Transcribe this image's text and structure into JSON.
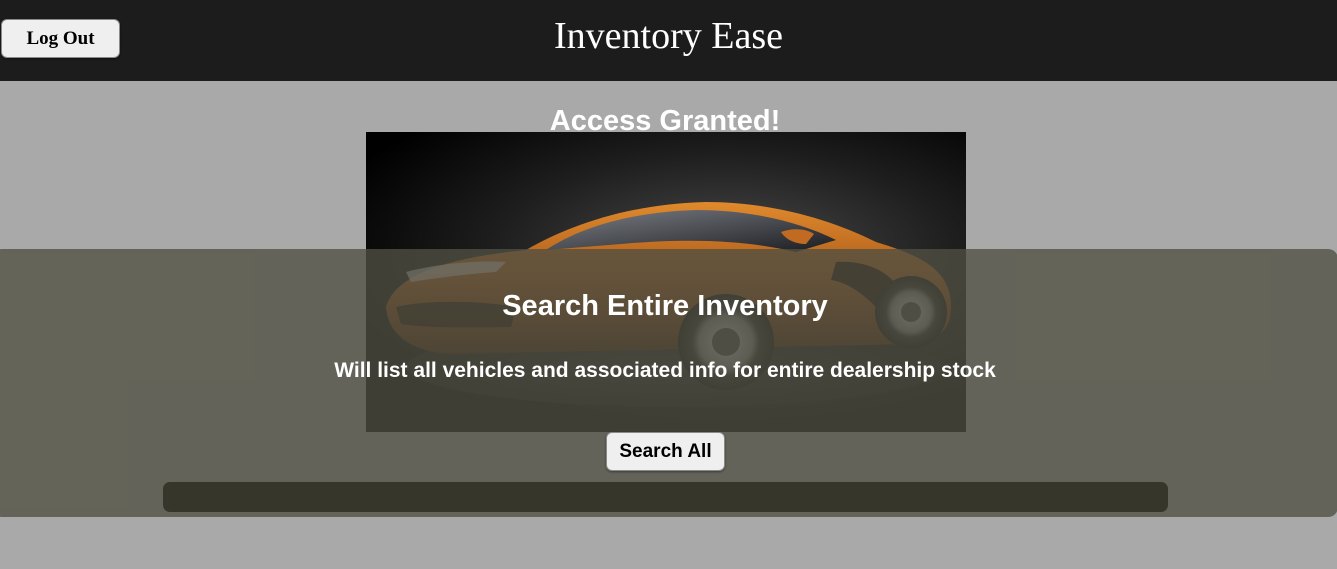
{
  "header": {
    "logout_label": "Log Out",
    "app_title": "Inventory Ease",
    "background_color": "#1c1c1c"
  },
  "status": {
    "message": "Access Granted!"
  },
  "hero_image": {
    "icon": "sports-car-image",
    "car_color": "#b5651d"
  },
  "search_panel": {
    "heading": "Search Entire Inventory",
    "description": "Will list all vehicles and associated info for entire dealership stock",
    "button_label": "Search All"
  },
  "results": {
    "text": ""
  }
}
